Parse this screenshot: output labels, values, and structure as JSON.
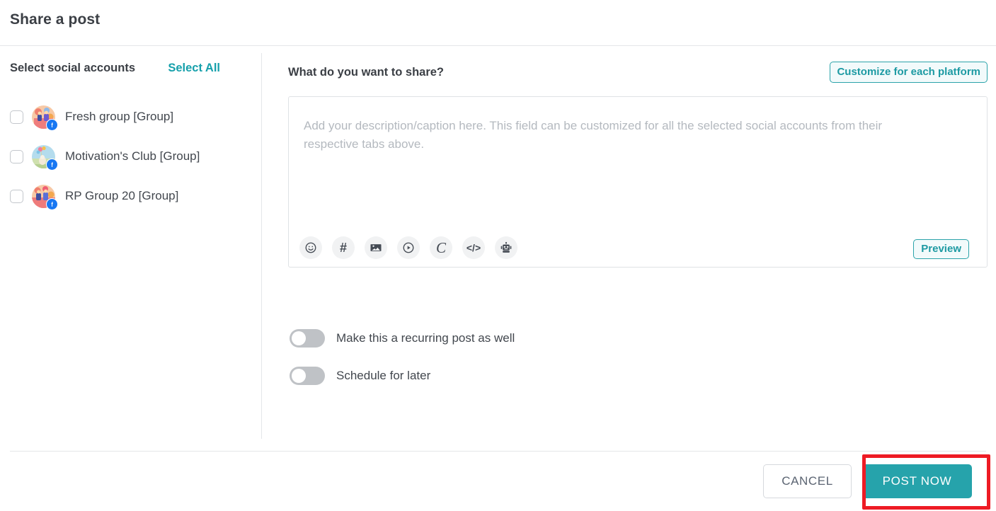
{
  "modal": {
    "title": "Share a post"
  },
  "accounts_panel": {
    "heading": "Select social accounts",
    "select_all_label": "Select All",
    "items": [
      {
        "name": "Fresh group [Group]",
        "platform": "facebook",
        "checked": false,
        "avatar_colors": [
          "#f6c7a4",
          "#f07b6a",
          "#4a5fa5"
        ]
      },
      {
        "name": "Motivation's Club [Group]",
        "platform": "facebook",
        "checked": false,
        "avatar_colors": [
          "#9fd2e8",
          "#cfe3b6",
          "#e8c07a"
        ]
      },
      {
        "name": "RP Group 20 [Group]",
        "platform": "facebook",
        "checked": false,
        "avatar_colors": [
          "#f3b9a0",
          "#e8596a",
          "#3f4fa0"
        ]
      }
    ]
  },
  "composer_panel": {
    "heading": "What do you want to share?",
    "customize_label": "Customize for each platform",
    "textarea_value": "",
    "textarea_placeholder": "Add your description/caption here. This field can be customized for all the selected social accounts from their respective tabs above.",
    "preview_label": "Preview",
    "toolbar_icons": [
      {
        "name": "emoji-icon",
        "title": "Emoji"
      },
      {
        "name": "hashtag-icon",
        "title": "Hashtag"
      },
      {
        "name": "image-icon",
        "title": "Image"
      },
      {
        "name": "video-icon",
        "title": "Video"
      },
      {
        "name": "canva-icon",
        "title": "Canva"
      },
      {
        "name": "code-icon",
        "title": "Code"
      },
      {
        "name": "ai-robot-icon",
        "title": "AI assistant"
      }
    ]
  },
  "options": {
    "recurring_label": "Make this a recurring post as well",
    "recurring_on": false,
    "schedule_label": "Schedule for later",
    "schedule_on": false
  },
  "footer": {
    "cancel_label": "CANCEL",
    "post_now_label": "POST NOW"
  },
  "colors": {
    "accent_teal": "#26a3ab",
    "accent_teal_text": "#1d9aa3",
    "highlight_red": "#ee1b24",
    "facebook_blue": "#1877f2",
    "text_primary": "#3b3f45",
    "text_secondary": "#42474e",
    "placeholder": "#b4b9bf",
    "border": "#e4e6e9"
  }
}
